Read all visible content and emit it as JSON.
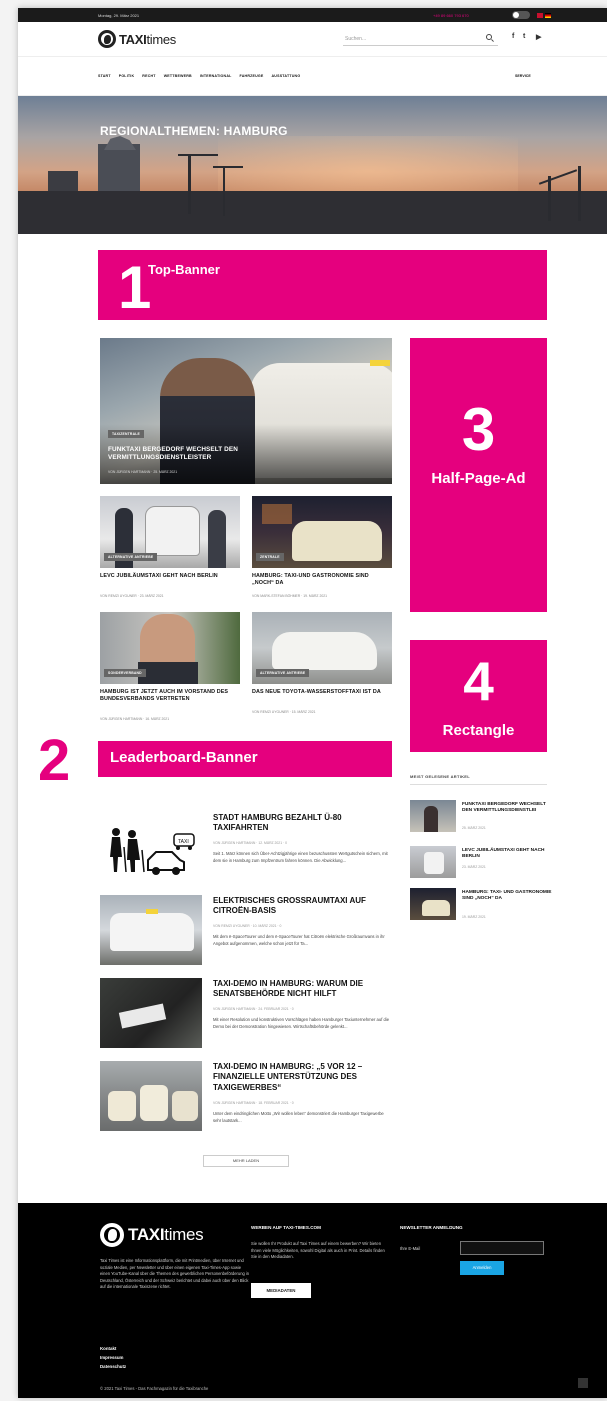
{
  "topbar": {
    "date": "Montag, 29. März 2021",
    "phone": "+49 89 660 793 670"
  },
  "header": {
    "logo_text_bold": "TAXI",
    "logo_text": "times",
    "search_placeholder": "Suchen...",
    "social": [
      "f",
      "t",
      "▶"
    ]
  },
  "nav": {
    "items": [
      "START",
      "POLITIK",
      "RECHT",
      "WETTBEWERB",
      "INTERNATIONAL",
      "FAHRZEUGE",
      "AUSSTATTUNG"
    ],
    "service": "SERVICE"
  },
  "hero": {
    "title": "REGIONALTHEMEN: HAMBURG"
  },
  "ads": {
    "top": {
      "num": "1",
      "label": "Top-Banner"
    },
    "leader": {
      "num": "2",
      "label": "Leaderboard-Banner"
    },
    "halfpage": {
      "num": "3",
      "label": "Half-Page-Ad"
    },
    "rect": {
      "num": "4",
      "label": "Rectangle"
    }
  },
  "featured": {
    "badge": "TAXIZENTRALE",
    "title": "FUNKTAXI BERGEDORF WECHSELT DEN VERMITTLUNGSDIENSTLEISTER",
    "meta": "VON JÜRGEN HARTMANN · 25. MÄRZ 2021"
  },
  "grid": [
    {
      "badge": "ALTERNATIVE ANTRIEBE",
      "title": "LEVC JUBILÄUMSTAXI GEHT NACH BERLIN",
      "meta": "VON REMZI UYGUNER · 23. MÄRZ 2021"
    },
    {
      "badge": "ZENTRALE",
      "title": "HAMBURG: TAXI-UND GASTRONOMIE SIND „NOCH“ DA",
      "meta": "VON MARK-STEFAN BÖHMER · 19. MÄRZ 2021"
    },
    {
      "badge": "SONDERVERBAND",
      "title": "HAMBURG IST JETZT AUCH IM VORSTAND DES BUNDESVERBANDS VERTRETEN",
      "meta": "VON JÜRGEN HARTMANN · 16. MÄRZ 2021"
    },
    {
      "badge": "ALTERNATIVE ANTRIEBE",
      "title": "DAS NEUE TOYOTA-WASSERSTOFFTAXI IST DA",
      "meta": "VON REMZI UYGUNER · 15. MÄRZ 2021"
    }
  ],
  "list": [
    {
      "title": "STADT HAMBURG BEZAHLT Ü-80 TAXIFAHRTEN",
      "meta": "VON JÜRGEN HARTMANN · 12. MÄRZ 2021 · 0",
      "excerpt": "Seit 1. März können sich Über-Achtzigjährige einen bezuschussten Wertgutschein sichern, mit dem sie in Hamburg zum Impfzentrum fahren können. Die Abwicklung..."
    },
    {
      "title": "ELEKTRISCHES GROSSRAUMTAXI AUF CITROËN-BASIS",
      "meta": "VON REMZI UYGUNER · 10. MÄRZ 2021 · 0",
      "excerpt": "Mit dem ë-SpaceTourer und dem ë-SpaceTourer hat Citroën elektrische Großraumvans in ihr Angebot aufgenommen, welche schon jetzt für Ta..."
    },
    {
      "title": "TAXI-DEMO IN HAMBURG: WARUM DIE SENATSBEHÖRDE NICHT HILFT",
      "meta": "VON JÜRGEN HARTMANN · 24. FEBRUAR 2021 · 0",
      "excerpt": "Mit einer Resolution und konstruktiven Vorschlägen haben Hamburger Taxiunternehmer auf die Demo bei der Demonstration hingewiesen. Wirtschaftsbehörde gelenkt..."
    },
    {
      "title": "TAXI-DEMO IN HAMBURG: „5 VOR 12 – FINANZIELLE UNTERSTÜTZUNG DES TAXIGEWERBES“",
      "meta": "VON JÜRGEN HARTMANN · 18. FEBRUAR 2021 · 0",
      "excerpt": "Unter dem eindringlichen Motto „Wir wollen leben“ demonstriert die Hamburger Taxigewerbe sehr lautstark..."
    }
  ],
  "more_button": "MEHR LADEN",
  "sidebar": {
    "heading": "MEIST GELESENE ARTIKEL",
    "items": [
      {
        "title": "FUNKTAXI BERGEDORF WECHSELT DEN VERMITTLUNGSDIENSTLEI",
        "date": "25. MÄRZ 2021"
      },
      {
        "title": "LEVC JUBILÄUMSTAXI GEHT NACH BERLIN",
        "date": "23. MÄRZ 2021"
      },
      {
        "title": "HAMBURG: TAXI- UND GASTRONOMIE SIND „NOCH“ DA",
        "date": "19. MÄRZ 2021"
      }
    ]
  },
  "footer": {
    "logo_bold": "TAXI",
    "logo": "times",
    "about": "Taxi Times ist eine Informationsplattform, die mit Printmedien, über Internet und soziale Medien, per Newsletter und über einen eigenen Taxi-Times-App sowie einen YouTube-Kanal über die Themen des gewerblichen Personenbeförderung in Deutschland, Österreich und der Schweiz berichtet und dabei auch über den Blick auf die internationale Taxiszene richtet.",
    "links": [
      "Kontakt",
      "Impressum",
      "Datenschutz"
    ],
    "copyright": "© 2021 Taxi Times - Das Fachmagazin für die Taxibranche",
    "ad_head": "WERBEN AUF TAXI-TIMES.COM",
    "ad_text": "Sie wollen Ihr Produkt auf Taxi Times auf einem bewerben? Wir bieten Ihnen viele Möglichkeiten, sowohl Digital als auch in Print. Details finden Sie in den Mediadaten.",
    "ad_button": "MEDIADATEN",
    "news_head": "NEWSLETTER ANMELDUNG",
    "email_label": "Ihre E-Mail",
    "submit": "Anmelden"
  },
  "colors": {
    "accent": "#e5007e",
    "dark": "#1b1b1b",
    "button_blue": "#1aa5e4"
  }
}
